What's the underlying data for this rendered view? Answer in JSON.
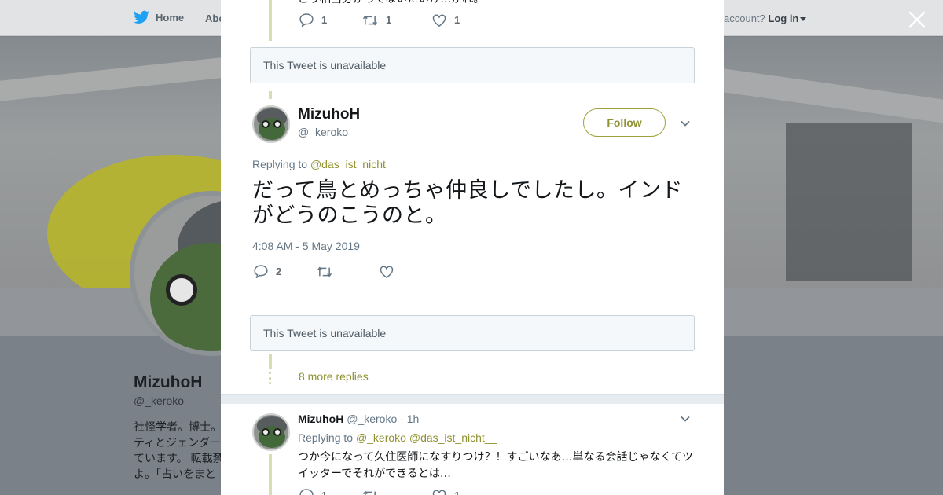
{
  "topbar": {
    "home_label": "Home",
    "about_label": "Abo",
    "account_prompt": "account?",
    "login_label": "Log in"
  },
  "profile": {
    "name": "MizuhoH",
    "handle": "@_keroko",
    "bio_fragment": "社怪学者。博士。ティとジェンダーています。 転載禁よ。「占いをまと"
  },
  "modal": {
    "top_tweet": {
      "text_fragment": "こう相当分かってないたいけ…がれ。",
      "reply_count": "1",
      "retweet_count": "1",
      "like_count": "1"
    },
    "unavailable_1": "This Tweet is unavailable",
    "main_tweet": {
      "name": "MizuhoH",
      "handle": "@_keroko",
      "follow_label": "Follow",
      "replying_prefix": "Replying to",
      "replying_to": "@das_ist_nicht__",
      "text": "だって鳥とめっちゃ仲良しでしたし。インドがどうのこうのと。",
      "timestamp": "4:08 AM - 5 May 2019",
      "reply_count": "2",
      "retweet_count": "",
      "like_count": ""
    },
    "unavailable_2": "This Tweet is unavailable",
    "more_replies": "8 more replies",
    "reply_tweet": {
      "name": "MizuhoH",
      "handle": "@_keroko",
      "time": "· 1h",
      "replying_prefix": "Replying to",
      "replying_to_1": "@_keroko",
      "replying_to_2": "@das_ist_nicht__",
      "text": "つか今になって久住医師になすりつけ？！すごいなあ…単なる会話じゃなくてツイッターでそれができるとは…",
      "reply_count": "1",
      "like_count": "1"
    }
  },
  "colors": {
    "accent": "#8f9131",
    "thread_line": "#d9ddb0",
    "twitter_blue": "#1da1f2"
  },
  "icons": [
    "twitter-bird-icon",
    "caret-down-icon",
    "close-icon",
    "reply-icon",
    "retweet-icon",
    "heart-icon",
    "chevron-down-icon"
  ]
}
